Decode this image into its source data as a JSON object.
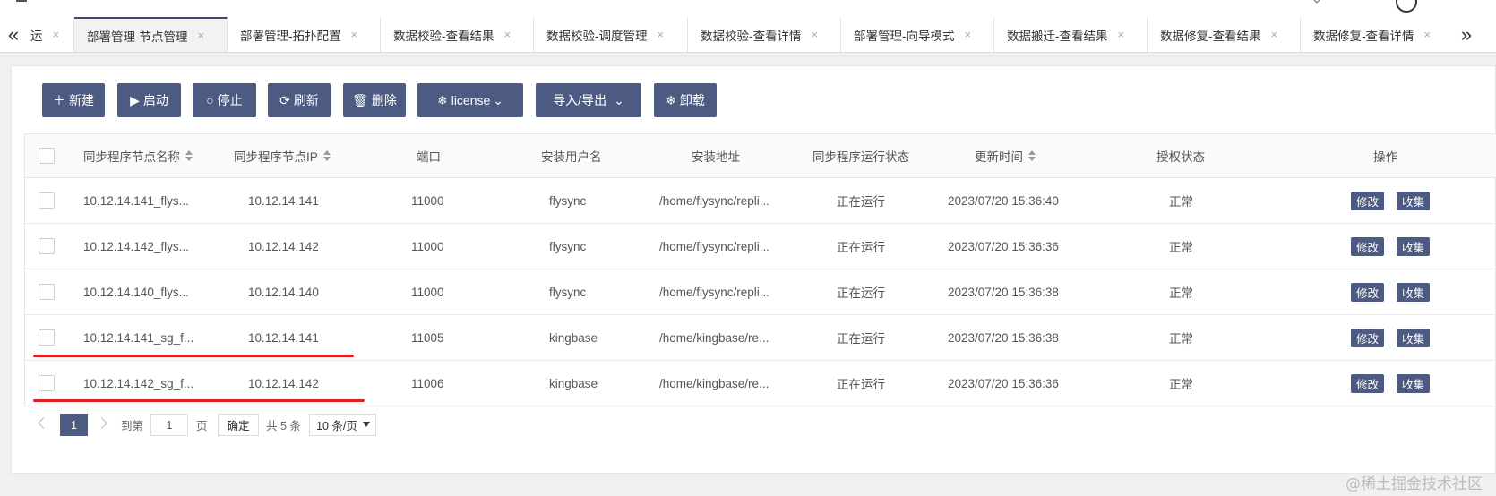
{
  "tabs": [
    {
      "label": "运",
      "active": false
    },
    {
      "label": "部署管理-节点管理",
      "active": true
    },
    {
      "label": "部署管理-拓扑配置",
      "active": false
    },
    {
      "label": "数据校验-查看结果",
      "active": false
    },
    {
      "label": "数据校验-调度管理",
      "active": false
    },
    {
      "label": "数据校验-查看详情",
      "active": false
    },
    {
      "label": "部署管理-向导模式",
      "active": false
    },
    {
      "label": "数据搬迁-查看结果",
      "active": false
    },
    {
      "label": "数据修复-查看结果",
      "active": false
    },
    {
      "label": "数据修复-查看详情",
      "active": false
    }
  ],
  "toolbar": {
    "new": "新建",
    "start": "启动",
    "stop": "停止",
    "refresh": "刷新",
    "delete": "删除",
    "license": "license",
    "import_export": "导入/导出",
    "uninstall": "卸载"
  },
  "table": {
    "headers": {
      "name": "同步程序节点名称",
      "ip": "同步程序节点IP",
      "port": "端口",
      "user": "安装用户名",
      "path": "安装地址",
      "status": "同步程序运行状态",
      "updated": "更新时间",
      "auth": "授权状态",
      "ops": "操作"
    },
    "rows": [
      {
        "name": "10.12.14.141_flys...",
        "ip": "10.12.14.141",
        "port": "11000",
        "user": "flysync",
        "path": "/home/flysync/repli...",
        "status": "正在运行",
        "updated": "2023/07/20 15:36:40",
        "auth": "正常"
      },
      {
        "name": "10.12.14.142_flys...",
        "ip": "10.12.14.142",
        "port": "11000",
        "user": "flysync",
        "path": "/home/flysync/repli...",
        "status": "正在运行",
        "updated": "2023/07/20 15:36:36",
        "auth": "正常"
      },
      {
        "name": "10.12.14.140_flys...",
        "ip": "10.12.14.140",
        "port": "11000",
        "user": "flysync",
        "path": "/home/flysync/repli...",
        "status": "正在运行",
        "updated": "2023/07/20 15:36:38",
        "auth": "正常"
      },
      {
        "name": "10.12.14.141_sg_f...",
        "ip": "10.12.14.141",
        "port": "11005",
        "user": "kingbase",
        "path": "/home/kingbase/re...",
        "status": "正在运行",
        "updated": "2023/07/20 15:36:38",
        "auth": "正常"
      },
      {
        "name": "10.12.14.142_sg_f...",
        "ip": "10.12.14.142",
        "port": "11006",
        "user": "kingbase",
        "path": "/home/kingbase/re...",
        "status": "正在运行",
        "updated": "2023/07/20 15:36:36",
        "auth": "正常"
      }
    ],
    "edit_label": "修改",
    "collect_label": "收集"
  },
  "pagination": {
    "current": "1",
    "goto_label": "到第",
    "page_value": "1",
    "page_unit": "页",
    "confirm": "确定",
    "total": "共 5 条",
    "page_size": "10 条/页"
  },
  "watermark": "@稀土掘金技术社区",
  "colors": {
    "accent": "#4d5b82",
    "annotation": "#e02020"
  }
}
